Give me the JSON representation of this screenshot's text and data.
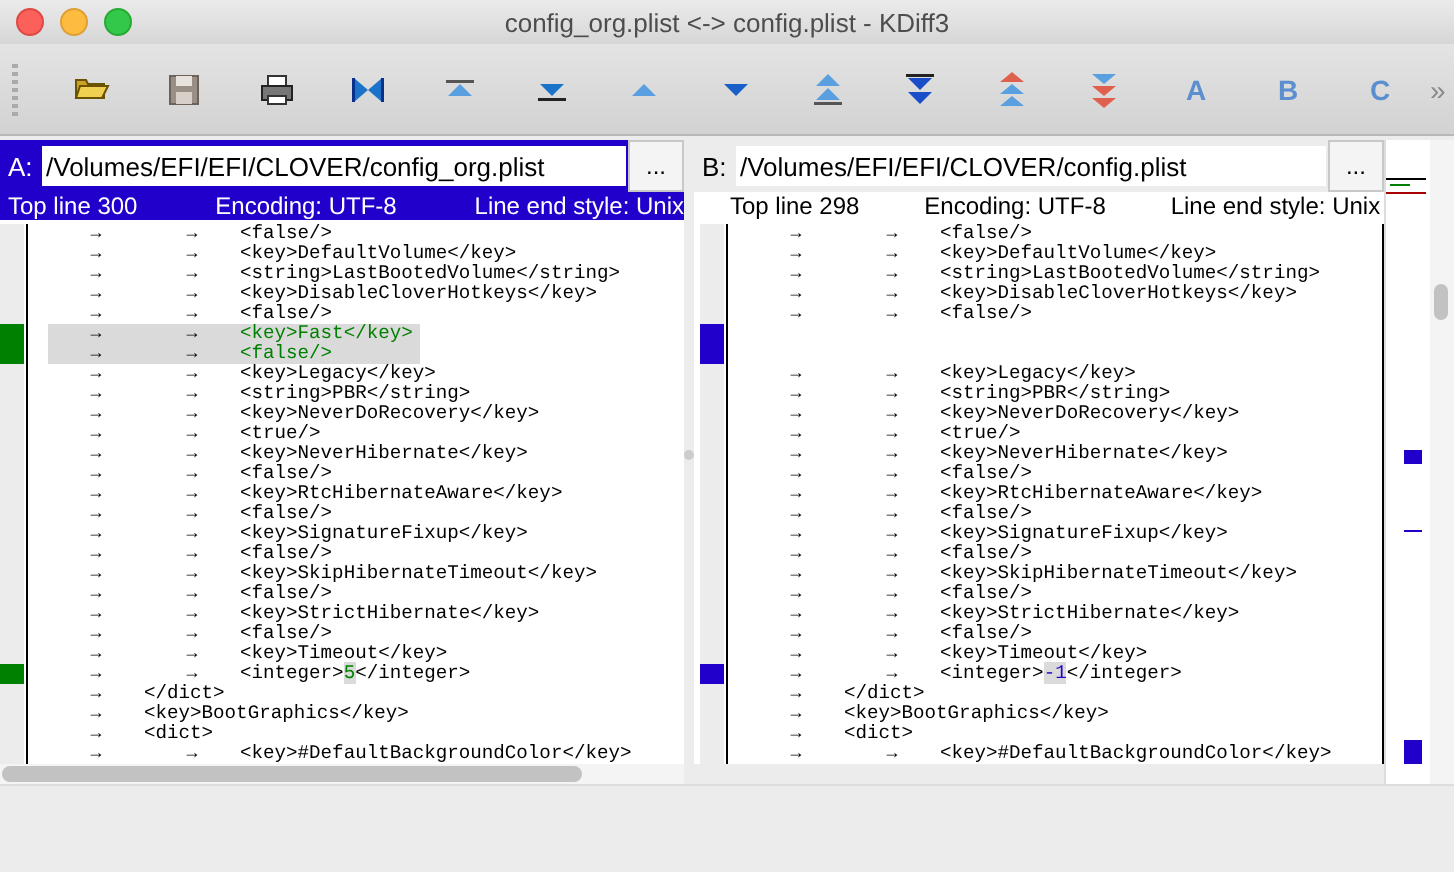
{
  "window": {
    "title": "config_org.plist <-> config.plist - KDiff3"
  },
  "toolbar": {
    "letter_buttons": [
      "A",
      "B",
      "C"
    ],
    "overflow": "»"
  },
  "panes": [
    {
      "label": "A:",
      "path": "/Volumes/EFI/EFI/CLOVER/config_org.plist",
      "browse_button": "...",
      "top_line": "Top line 300",
      "encoding": "Encoding: UTF-8",
      "line_end": "Line end style: Unix",
      "active": true,
      "color": "#008000",
      "lines": [
        {
          "kind": "same",
          "tabs": [
            "→",
            "→"
          ],
          "text": "<false/>"
        },
        {
          "kind": "same",
          "tabs": [
            "→",
            "→"
          ],
          "text": "<key>DefaultVolume</key>"
        },
        {
          "kind": "same",
          "tabs": [
            "→",
            "→"
          ],
          "text": "<string>LastBootedVolume</string>"
        },
        {
          "kind": "same",
          "tabs": [
            "→",
            "→"
          ],
          "text": "<key>DisableCloverHotkeys</key>"
        },
        {
          "kind": "same",
          "tabs": [
            "→",
            "→"
          ],
          "text": "<false/>"
        },
        {
          "kind": "only",
          "tabs": [
            "→",
            "→"
          ],
          "text": "<key>Fast</key>"
        },
        {
          "kind": "only",
          "tabs": [
            "→",
            "→"
          ],
          "text": "<false/>"
        },
        {
          "kind": "same",
          "tabs": [
            "→",
            "→"
          ],
          "text": "<key>Legacy</key>"
        },
        {
          "kind": "same",
          "tabs": [
            "→",
            "→"
          ],
          "text": "<string>PBR</string>"
        },
        {
          "kind": "same",
          "tabs": [
            "→",
            "→"
          ],
          "text": "<key>NeverDoRecovery</key>"
        },
        {
          "kind": "same",
          "tabs": [
            "→",
            "→"
          ],
          "text": "<true/>"
        },
        {
          "kind": "same",
          "tabs": [
            "→",
            "→"
          ],
          "text": "<key>NeverHibernate</key>"
        },
        {
          "kind": "same",
          "tabs": [
            "→",
            "→"
          ],
          "text": "<false/>"
        },
        {
          "kind": "same",
          "tabs": [
            "→",
            "→"
          ],
          "text": "<key>RtcHibernateAware</key>"
        },
        {
          "kind": "same",
          "tabs": [
            "→",
            "→"
          ],
          "text": "<false/>"
        },
        {
          "kind": "same",
          "tabs": [
            "→",
            "→"
          ],
          "text": "<key>SignatureFixup</key>"
        },
        {
          "kind": "same",
          "tabs": [
            "→",
            "→"
          ],
          "text": "<false/>"
        },
        {
          "kind": "same",
          "tabs": [
            "→",
            "→"
          ],
          "text": "<key>SkipHibernateTimeout</key>"
        },
        {
          "kind": "same",
          "tabs": [
            "→",
            "→"
          ],
          "text": "<false/>"
        },
        {
          "kind": "same",
          "tabs": [
            "→",
            "→"
          ],
          "text": "<key>StrictHibernate</key>"
        },
        {
          "kind": "same",
          "tabs": [
            "→",
            "→"
          ],
          "text": "<false/>"
        },
        {
          "kind": "same",
          "tabs": [
            "→",
            "→"
          ],
          "text": "<key>Timeout</key>"
        },
        {
          "kind": "modified",
          "tabs": [
            "→",
            "→"
          ],
          "segments": [
            {
              "text": "<integer>",
              "changed": false
            },
            {
              "text": "5",
              "changed": true
            },
            {
              "text": "</integer>",
              "changed": false
            }
          ]
        },
        {
          "kind": "same",
          "tabs": [
            "→"
          ],
          "text": "</dict>"
        },
        {
          "kind": "same",
          "tabs": [
            "→"
          ],
          "text": "<key>BootGraphics</key>"
        },
        {
          "kind": "same",
          "tabs": [
            "→"
          ],
          "text": "<dict>"
        },
        {
          "kind": "same",
          "tabs": [
            "→",
            "→"
          ],
          "text": "<key>#DefaultBackgroundColor</key>"
        }
      ]
    },
    {
      "label": "B:",
      "path": "/Volumes/EFI/EFI/CLOVER/config.plist",
      "browse_button": "...",
      "top_line": "Top line 298",
      "encoding": "Encoding: UTF-8",
      "line_end": "Line end style: Unix",
      "active": false,
      "color": "#2200cc",
      "lines": [
        {
          "kind": "same",
          "tabs": [
            "→",
            "→"
          ],
          "text": "<false/>"
        },
        {
          "kind": "same",
          "tabs": [
            "→",
            "→"
          ],
          "text": "<key>DefaultVolume</key>"
        },
        {
          "kind": "same",
          "tabs": [
            "→",
            "→"
          ],
          "text": "<string>LastBootedVolume</string>"
        },
        {
          "kind": "same",
          "tabs": [
            "→",
            "→"
          ],
          "text": "<key>DisableCloverHotkeys</key>"
        },
        {
          "kind": "same",
          "tabs": [
            "→",
            "→"
          ],
          "text": "<false/>"
        },
        {
          "kind": "blank"
        },
        {
          "kind": "blank"
        },
        {
          "kind": "same",
          "tabs": [
            "→",
            "→"
          ],
          "text": "<key>Legacy</key>"
        },
        {
          "kind": "same",
          "tabs": [
            "→",
            "→"
          ],
          "text": "<string>PBR</string>"
        },
        {
          "kind": "same",
          "tabs": [
            "→",
            "→"
          ],
          "text": "<key>NeverDoRecovery</key>"
        },
        {
          "kind": "same",
          "tabs": [
            "→",
            "→"
          ],
          "text": "<true/>"
        },
        {
          "kind": "same",
          "tabs": [
            "→",
            "→"
          ],
          "text": "<key>NeverHibernate</key>"
        },
        {
          "kind": "same",
          "tabs": [
            "→",
            "→"
          ],
          "text": "<false/>"
        },
        {
          "kind": "same",
          "tabs": [
            "→",
            "→"
          ],
          "text": "<key>RtcHibernateAware</key>"
        },
        {
          "kind": "same",
          "tabs": [
            "→",
            "→"
          ],
          "text": "<false/>"
        },
        {
          "kind": "same",
          "tabs": [
            "→",
            "→"
          ],
          "text": "<key>SignatureFixup</key>"
        },
        {
          "kind": "same",
          "tabs": [
            "→",
            "→"
          ],
          "text": "<false/>"
        },
        {
          "kind": "same",
          "tabs": [
            "→",
            "→"
          ],
          "text": "<key>SkipHibernateTimeout</key>"
        },
        {
          "kind": "same",
          "tabs": [
            "→",
            "→"
          ],
          "text": "<false/>"
        },
        {
          "kind": "same",
          "tabs": [
            "→",
            "→"
          ],
          "text": "<key>StrictHibernate</key>"
        },
        {
          "kind": "same",
          "tabs": [
            "→",
            "→"
          ],
          "text": "<false/>"
        },
        {
          "kind": "same",
          "tabs": [
            "→",
            "→"
          ],
          "text": "<key>Timeout</key>"
        },
        {
          "kind": "modified",
          "tabs": [
            "→",
            "→"
          ],
          "segments": [
            {
              "text": "<integer>",
              "changed": false
            },
            {
              "text": "-1",
              "changed": true
            },
            {
              "text": "</integer>",
              "changed": false
            }
          ]
        },
        {
          "kind": "same",
          "tabs": [
            "→"
          ],
          "text": "</dict>"
        },
        {
          "kind": "same",
          "tabs": [
            "→"
          ],
          "text": "<key>BootGraphics</key>"
        },
        {
          "kind": "same",
          "tabs": [
            "→"
          ],
          "text": "<dict>"
        },
        {
          "kind": "same",
          "tabs": [
            "→",
            "→"
          ],
          "text": "<key>#DefaultBackgroundColor</key>"
        }
      ]
    }
  ]
}
